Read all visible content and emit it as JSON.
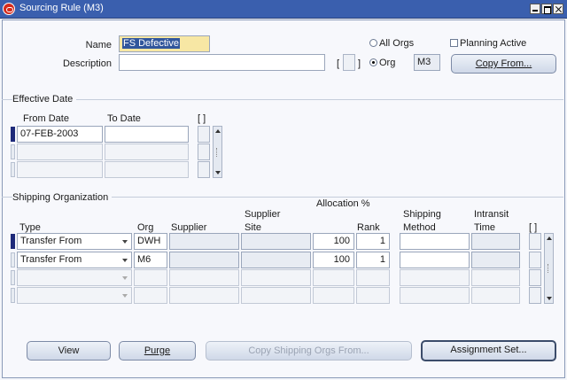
{
  "window": {
    "title": "Sourcing Rule (M3)"
  },
  "header": {
    "name_label": "Name",
    "name_value": "FS Defective",
    "description_label": "Description",
    "description_value": "",
    "desc_bracket_open": "[",
    "desc_bracket_close": "]",
    "all_orgs_label": "All Orgs",
    "org_label": "Org",
    "org_value": "M3",
    "org_selected": "Org",
    "planning_active_label": "Planning Active",
    "copy_from_button": "Copy From..."
  },
  "effective_date": {
    "section_title": "Effective Date",
    "columns": [
      "From Date",
      "To Date"
    ],
    "flex_bracket": "[ ]",
    "rows": [
      {
        "from_date": "07-FEB-2003",
        "to_date": ""
      },
      {
        "from_date": "",
        "to_date": ""
      },
      {
        "from_date": "",
        "to_date": ""
      }
    ]
  },
  "shipping": {
    "section_title": "Shipping Organization",
    "allocation_header": "Allocation %",
    "columns": {
      "type": "Type",
      "org": "Org",
      "supplier": "Supplier",
      "supplier_site_1": "Supplier",
      "supplier_site_2": "Site",
      "rank": "Rank",
      "shipping_method_1": "Shipping",
      "shipping_method_2": "Method",
      "intransit_time_1": "Intransit",
      "intransit_time_2": "Time",
      "flex": "[ ]"
    },
    "rows": [
      {
        "type": "Transfer From",
        "org": "DWH",
        "supplier": "",
        "supplier_site": "",
        "allocation": "100",
        "rank": "1",
        "shipping_method": "",
        "intransit_time": ""
      },
      {
        "type": "Transfer From",
        "org": "M6",
        "supplier": "",
        "supplier_site": "",
        "allocation": "100",
        "rank": "1",
        "shipping_method": "",
        "intransit_time": ""
      },
      {
        "type": "",
        "org": "",
        "supplier": "",
        "supplier_site": "",
        "allocation": "",
        "rank": "",
        "shipping_method": "",
        "intransit_time": ""
      },
      {
        "type": "",
        "org": "",
        "supplier": "",
        "supplier_site": "",
        "allocation": "",
        "rank": "",
        "shipping_method": "",
        "intransit_time": ""
      }
    ]
  },
  "footer": {
    "view_button": "View",
    "purge_button": "Purge",
    "copy_shipping_button": "Copy Shipping Orgs From...",
    "assignment_set_button": "Assignment Set..."
  },
  "colors": {
    "titlebar": "#3a5fae",
    "highlight_field": "#f7e7a4",
    "current_record": "#1e2a7a"
  }
}
